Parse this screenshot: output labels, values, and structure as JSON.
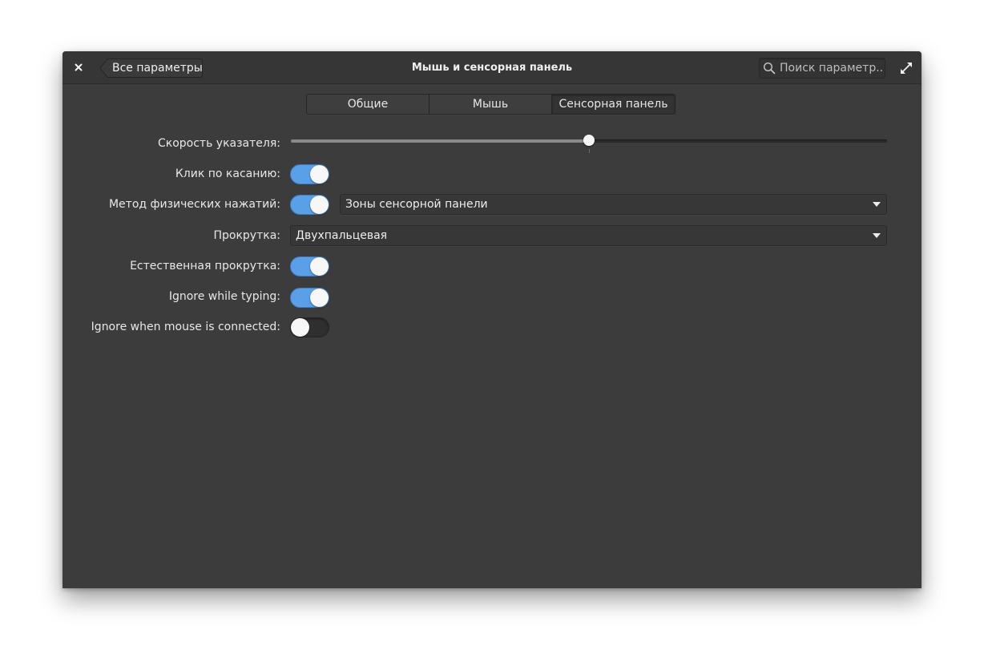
{
  "window": {
    "title": "Мышь и сенсорная панель",
    "back_label": "Все параметры",
    "search_placeholder": "Поиск параметр...",
    "icons": {
      "close": "close-icon",
      "search": "search-icon",
      "maximize": "maximize-icon"
    }
  },
  "tabs": [
    {
      "label": "Общие",
      "active": false
    },
    {
      "label": "Мышь",
      "active": false
    },
    {
      "label": "Сенсорная панель",
      "active": true
    }
  ],
  "settings": {
    "pointer_speed": {
      "label": "Скорость указателя:",
      "value_fraction": 0.5
    },
    "tap_to_click": {
      "label": "Клик по касанию:",
      "on": true
    },
    "click_method": {
      "label": "Метод физических нажатий:",
      "on": true,
      "selected": "Зоны сенсорной панели"
    },
    "scrolling": {
      "label": "Прокрутка:",
      "selected": "Двухпальцевая"
    },
    "natural_scrolling": {
      "label": "Естественная прокрутка:",
      "on": true
    },
    "ignore_while_typing": {
      "label": "Ignore while typing:",
      "on": true
    },
    "ignore_with_mouse": {
      "label": "Ignore when mouse is connected:",
      "on": false
    }
  },
  "colors": {
    "accent": "#5aa0e8",
    "window_bg": "#3c3c3c",
    "titlebar_bg": "#363636"
  }
}
